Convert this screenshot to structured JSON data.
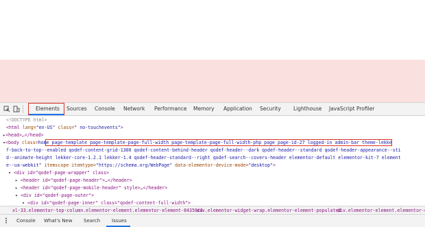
{
  "tabs": [
    "Elements",
    "Sources",
    "Console",
    "Network",
    "Performance",
    "Memory",
    "Application",
    "Security",
    "Lighthouse",
    "JavaScript Profiler"
  ],
  "active_tab": "Elements",
  "html_lines": {
    "doctype": "<!DOCTYPE html>",
    "html_open_tag": "<html",
    "html_lang_attr": " lang=",
    "html_lang_val": "\"en-US\"",
    "html_class_attr": " class=",
    "html_class_val": "\" no-touchevents\"",
    "html_close": ">",
    "head": "<head>…</head>",
    "body_open": "<body",
    "body_class_attr": " class=",
    "body_class_val_hl": "home page-template page-template-page-full-width page-template-page-full-width-php page page-id-27 logged-in admin-bar",
    "body_class_val_rest": " theme-lekke",
    "body_cont1": "f-back-to-top--enabled qodef-content-grid-1300 qodef-content-behind-header qodef-header--dark qodef-header--standard qodef-header-appearance--sti",
    "body_cont2": "d--animate-height lekker-core-1.2.1 lekker-1.4 qodef-header-standard--right qodef-search--covers-header elementor-default elementor-kit-7 element",
    "body_cont3_a": "e--ua-webkit\"",
    "body_cont3_b": " itemscope itemtype=",
    "body_cont3_c": "\"https://schema.org/WebPage\"",
    "body_cont3_d": " data-elementor-device-mode=",
    "body_cont3_e": "\"desktop\"",
    "body_cont3_f": ">",
    "wrapper": "<div id=\"qodef-page-wrapper\" class>",
    "header1": "<header id=\"qodef-page-header\">…</header>",
    "header2": "<header id=\"qodef-page-mobile-header\" style>…</header>",
    "outer": "<div id=\"qodef-page-outer\">",
    "inner": "<div id=\"qodef-page-inner\" class=\"qodef-content-full-width\">"
  },
  "breadcrumbs": {
    "b1": "xl-33.elementor-top-column.elementor-element.elementor-element-84356c4",
    "b2": "div.elementor-widget-wrap.elementor-element-populated",
    "b3": "div.elementor-element.elementor-ele"
  },
  "drawer_tabs": [
    "Console",
    "What's New",
    "Search",
    "Issues"
  ],
  "drawer_active": "Issues",
  "colors": {
    "highlight_border": "#d93025",
    "active_blue": "#1a73e8",
    "page_pink": "#fbe0e0"
  }
}
